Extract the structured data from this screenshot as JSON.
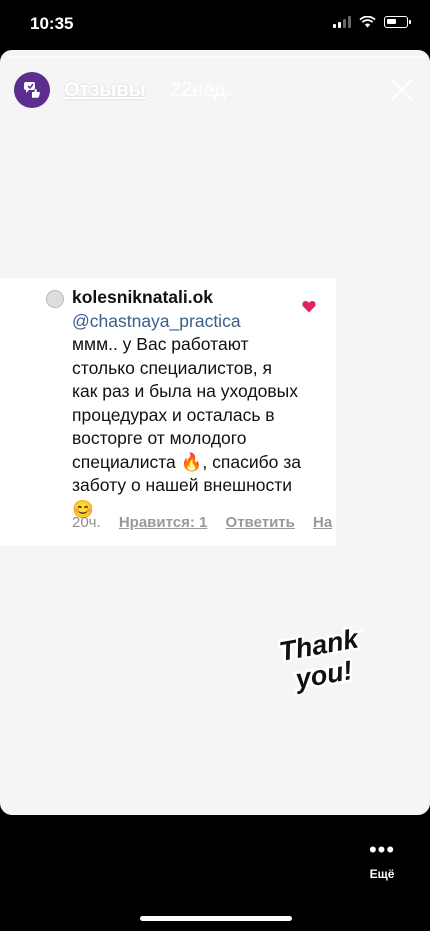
{
  "status_bar": {
    "time": "10:35"
  },
  "story": {
    "account_name": "Отзывы",
    "age": "22нед.",
    "comment": {
      "username": "kolesniknatali.ok",
      "mention": "@chastnaya_practica",
      "text": "ммм.. у Вас работают столько специалистов, я как раз и была на уходовых процедурах и осталась в восторге от молодого специалиста 🔥, спасибо за заботу о нашей внешности😊",
      "time": "20ч.",
      "likes": "Нравится: 1",
      "reply": "Ответить",
      "more": "На"
    },
    "sticker_text": [
      "Thank",
      "you!"
    ]
  },
  "bottom": {
    "more_label": "Ещё"
  },
  "colors": {
    "avatar_bg": "#5b2d8e",
    "heart": "#e0245e",
    "mention": "#3a5e8c"
  }
}
